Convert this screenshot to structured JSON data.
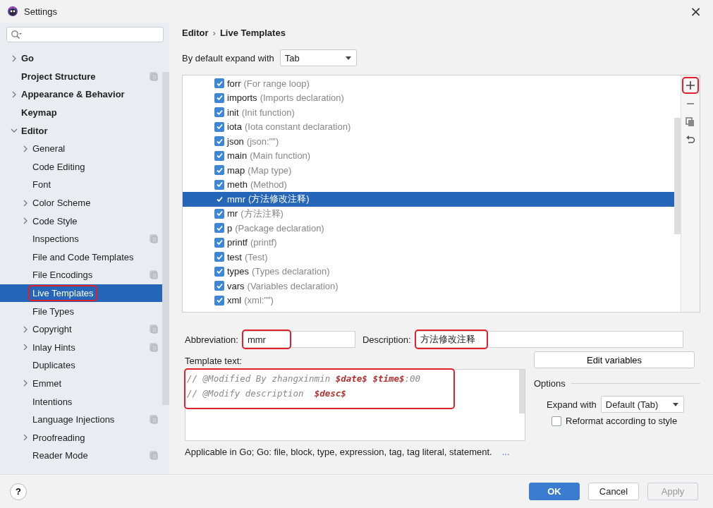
{
  "window": {
    "title": "Settings",
    "close": "×"
  },
  "sidebar": {
    "items": [
      {
        "label": "Go",
        "bold": true,
        "expandable": true,
        "expanded": false,
        "project_level": false,
        "selected": false,
        "highlighted": false
      },
      {
        "label": "Project Structure",
        "bold": true,
        "expandable": false,
        "project_level": true,
        "selected": false,
        "highlighted": false
      },
      {
        "label": "Appearance & Behavior",
        "bold": true,
        "expandable": true,
        "expanded": false,
        "project_level": false,
        "selected": false,
        "highlighted": false
      },
      {
        "label": "Keymap",
        "bold": true,
        "expandable": false,
        "project_level": false,
        "selected": false,
        "highlighted": false
      },
      {
        "label": "Editor",
        "bold": true,
        "expandable": true,
        "expanded": true,
        "project_level": false,
        "selected": false,
        "highlighted": false,
        "children": [
          {
            "label": "General",
            "bold": false,
            "expandable": true,
            "expanded": false,
            "project_level": false,
            "selected": false,
            "highlighted": false
          },
          {
            "label": "Code Editing",
            "bold": false,
            "expandable": false,
            "project_level": false,
            "selected": false,
            "highlighted": false
          },
          {
            "label": "Font",
            "bold": false,
            "expandable": false,
            "project_level": false,
            "selected": false,
            "highlighted": false
          },
          {
            "label": "Color Scheme",
            "bold": false,
            "expandable": true,
            "expanded": false,
            "project_level": false,
            "selected": false,
            "highlighted": false
          },
          {
            "label": "Code Style",
            "bold": false,
            "expandable": true,
            "expanded": false,
            "project_level": false,
            "selected": false,
            "highlighted": false
          },
          {
            "label": "Inspections",
            "bold": false,
            "expandable": false,
            "project_level": true,
            "selected": false,
            "highlighted": false
          },
          {
            "label": "File and Code Templates",
            "bold": false,
            "expandable": false,
            "project_level": false,
            "selected": false,
            "highlighted": false
          },
          {
            "label": "File Encodings",
            "bold": false,
            "expandable": false,
            "project_level": true,
            "selected": false,
            "highlighted": false
          },
          {
            "label": "Live Templates",
            "bold": false,
            "expandable": false,
            "project_level": false,
            "selected": true,
            "highlighted": true
          },
          {
            "label": "File Types",
            "bold": false,
            "expandable": false,
            "project_level": false,
            "selected": false,
            "highlighted": false
          },
          {
            "label": "Copyright",
            "bold": false,
            "expandable": true,
            "expanded": false,
            "project_level": true,
            "selected": false,
            "highlighted": false
          },
          {
            "label": "Inlay Hints",
            "bold": false,
            "expandable": true,
            "expanded": false,
            "project_level": true,
            "selected": false,
            "highlighted": false
          },
          {
            "label": "Duplicates",
            "bold": false,
            "expandable": false,
            "project_level": false,
            "selected": false,
            "highlighted": false
          },
          {
            "label": "Emmet",
            "bold": false,
            "expandable": true,
            "expanded": false,
            "project_level": false,
            "selected": false,
            "highlighted": false
          },
          {
            "label": "Intentions",
            "bold": false,
            "expandable": false,
            "project_level": false,
            "selected": false,
            "highlighted": false
          },
          {
            "label": "Language Injections",
            "bold": false,
            "expandable": false,
            "project_level": true,
            "selected": false,
            "highlighted": false
          },
          {
            "label": "Proofreading",
            "bold": false,
            "expandable": true,
            "expanded": false,
            "project_level": false,
            "selected": false,
            "highlighted": false
          },
          {
            "label": "Reader Mode",
            "bold": false,
            "expandable": false,
            "project_level": true,
            "selected": false,
            "highlighted": false
          }
        ]
      }
    ]
  },
  "breadcrumb": [
    "Editor",
    "›",
    "Live Templates"
  ],
  "expand_default": {
    "label": "By default expand with",
    "value": "Tab"
  },
  "templates": [
    {
      "abbr": "forr",
      "desc": "(For range loop)",
      "checked": true,
      "selected": false
    },
    {
      "abbr": "imports",
      "desc": "(Imports declaration)",
      "checked": true,
      "selected": false
    },
    {
      "abbr": "init",
      "desc": "(Init function)",
      "checked": true,
      "selected": false
    },
    {
      "abbr": "iota",
      "desc": "(Iota constant declaration)",
      "checked": true,
      "selected": false
    },
    {
      "abbr": "json",
      "desc": "(json:\"\")",
      "checked": true,
      "selected": false
    },
    {
      "abbr": "main",
      "desc": "(Main function)",
      "checked": true,
      "selected": false
    },
    {
      "abbr": "map",
      "desc": "(Map type)",
      "checked": true,
      "selected": false
    },
    {
      "abbr": "meth",
      "desc": "(Method)",
      "checked": true,
      "selected": false
    },
    {
      "abbr": "mmr",
      "desc": "(方法修改注释)",
      "checked": true,
      "selected": true
    },
    {
      "abbr": "mr",
      "desc": "(方法注释)",
      "checked": true,
      "selected": false
    },
    {
      "abbr": "p",
      "desc": "(Package declaration)",
      "checked": true,
      "selected": false
    },
    {
      "abbr": "printf",
      "desc": "(printf)",
      "checked": true,
      "selected": false
    },
    {
      "abbr": "test",
      "desc": "(Test)",
      "checked": true,
      "selected": false
    },
    {
      "abbr": "types",
      "desc": "(Types declaration)",
      "checked": true,
      "selected": false
    },
    {
      "abbr": "vars",
      "desc": "(Variables declaration)",
      "checked": true,
      "selected": false
    },
    {
      "abbr": "xml",
      "desc": "(xml:\"\")",
      "checked": true,
      "selected": false
    }
  ],
  "toolbar": [
    {
      "kind": "add",
      "highlighted": true
    },
    {
      "kind": "remove",
      "highlighted": false
    },
    {
      "kind": "copy",
      "highlighted": false
    },
    {
      "kind": "revert",
      "highlighted": false
    }
  ],
  "abbreviation": {
    "label": "Abbreviation:",
    "value": "mmr",
    "highlighted": true
  },
  "description": {
    "label": "Description:",
    "value": "方法修改注释",
    "highlighted": true
  },
  "template_text": {
    "label": "Template text:",
    "highlighted": true,
    "lines": [
      [
        {
          "kind": "comment",
          "text": "// @Modified By zhangxinmin "
        },
        {
          "kind": "variable",
          "text": "$date$ "
        },
        {
          "kind": "variable",
          "text": "$time$"
        },
        {
          "kind": "comment",
          "text": ":00"
        }
      ],
      [
        {
          "kind": "comment",
          "text": "// @Modify description  "
        },
        {
          "kind": "variable",
          "text": "$desc$"
        }
      ]
    ]
  },
  "edit_variables": "Edit variables",
  "options": {
    "title": "Options",
    "expand_with": {
      "label": "Expand with",
      "value": "Default (Tab)"
    },
    "reformat": {
      "label": "Reformat according to style",
      "checked": false
    }
  },
  "applicable": {
    "text": "Applicable in Go; Go: file, block, type, expression, tag, tag literal, statement.",
    "link": "..."
  },
  "footer": {
    "help": "?",
    "buttons": [
      {
        "label": "OK",
        "primary": true,
        "disabled": false
      },
      {
        "label": "Cancel",
        "primary": false,
        "disabled": false
      },
      {
        "label": "Apply",
        "primary": false,
        "disabled": true
      }
    ]
  }
}
